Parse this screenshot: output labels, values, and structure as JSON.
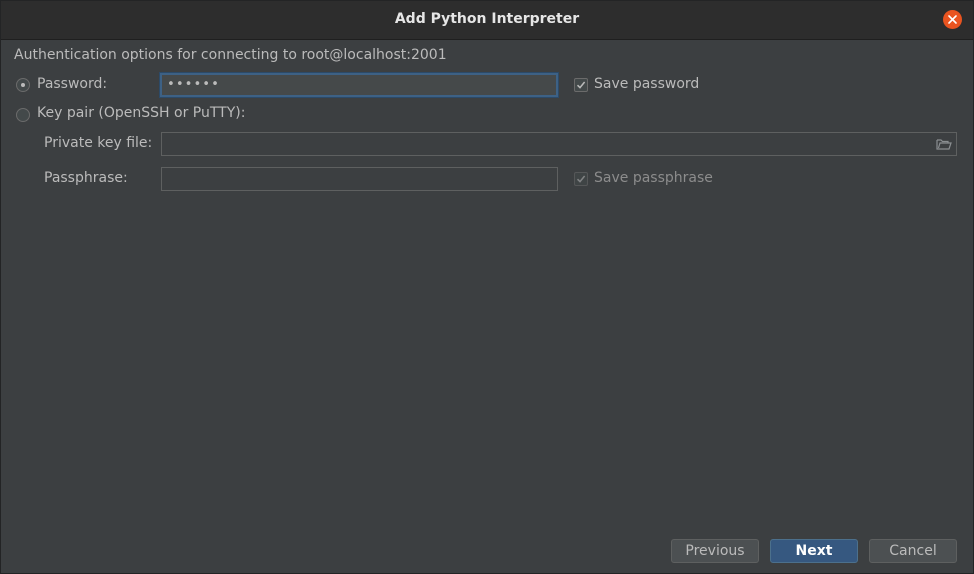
{
  "window": {
    "title": "Add Python Interpreter"
  },
  "auth": {
    "caption": "Authentication options for connecting to root@localhost:2001",
    "password_option": {
      "label": "Password:",
      "selected": true,
      "value": "••••••",
      "save_label": "Save password",
      "save_checked": true
    },
    "keypair_option": {
      "label": "Key pair (OpenSSH or PuTTY):",
      "selected": false,
      "private_key_label": "Private key file:",
      "private_key_value": "",
      "passphrase_label": "Passphrase:",
      "passphrase_value": "",
      "save_passphrase_label": "Save passphrase",
      "save_passphrase_checked": true
    }
  },
  "footer": {
    "previous_label": "Previous",
    "next_label": "Next",
    "cancel_label": "Cancel"
  },
  "icons": {
    "close": "close-icon",
    "folder": "folder-icon",
    "check": "checkmark-icon"
  },
  "colors": {
    "background": "#3c3f41",
    "titlebar": "#2d2d2d",
    "close_button": "#e95420",
    "focus_border": "#3d6185",
    "primary_button": "#365880",
    "text": "#bbbbbb"
  }
}
